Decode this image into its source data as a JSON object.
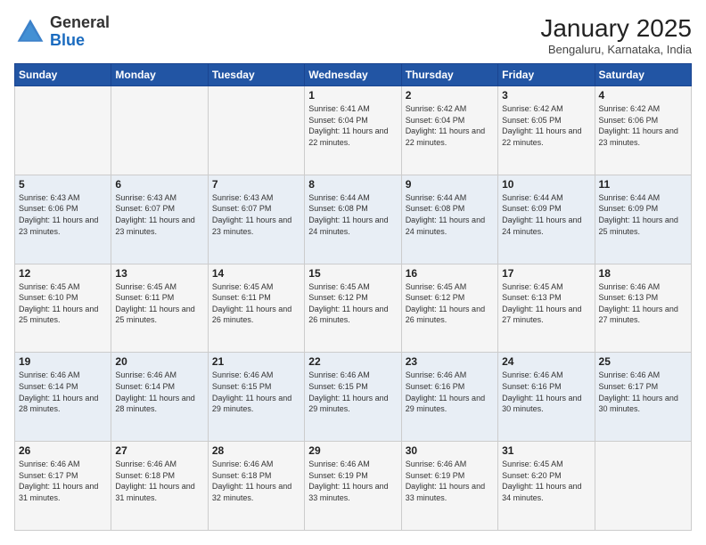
{
  "header": {
    "logo_general": "General",
    "logo_blue": "Blue",
    "month_year": "January 2025",
    "location": "Bengaluru, Karnataka, India"
  },
  "weekdays": [
    "Sunday",
    "Monday",
    "Tuesday",
    "Wednesday",
    "Thursday",
    "Friday",
    "Saturday"
  ],
  "weeks": [
    [
      {
        "day": "",
        "sunrise": "",
        "sunset": "",
        "daylight": ""
      },
      {
        "day": "",
        "sunrise": "",
        "sunset": "",
        "daylight": ""
      },
      {
        "day": "",
        "sunrise": "",
        "sunset": "",
        "daylight": ""
      },
      {
        "day": "1",
        "sunrise": "Sunrise: 6:41 AM",
        "sunset": "Sunset: 6:04 PM",
        "daylight": "Daylight: 11 hours and 22 minutes."
      },
      {
        "day": "2",
        "sunrise": "Sunrise: 6:42 AM",
        "sunset": "Sunset: 6:04 PM",
        "daylight": "Daylight: 11 hours and 22 minutes."
      },
      {
        "day": "3",
        "sunrise": "Sunrise: 6:42 AM",
        "sunset": "Sunset: 6:05 PM",
        "daylight": "Daylight: 11 hours and 22 minutes."
      },
      {
        "day": "4",
        "sunrise": "Sunrise: 6:42 AM",
        "sunset": "Sunset: 6:06 PM",
        "daylight": "Daylight: 11 hours and 23 minutes."
      }
    ],
    [
      {
        "day": "5",
        "sunrise": "Sunrise: 6:43 AM",
        "sunset": "Sunset: 6:06 PM",
        "daylight": "Daylight: 11 hours and 23 minutes."
      },
      {
        "day": "6",
        "sunrise": "Sunrise: 6:43 AM",
        "sunset": "Sunset: 6:07 PM",
        "daylight": "Daylight: 11 hours and 23 minutes."
      },
      {
        "day": "7",
        "sunrise": "Sunrise: 6:43 AM",
        "sunset": "Sunset: 6:07 PM",
        "daylight": "Daylight: 11 hours and 23 minutes."
      },
      {
        "day": "8",
        "sunrise": "Sunrise: 6:44 AM",
        "sunset": "Sunset: 6:08 PM",
        "daylight": "Daylight: 11 hours and 24 minutes."
      },
      {
        "day": "9",
        "sunrise": "Sunrise: 6:44 AM",
        "sunset": "Sunset: 6:08 PM",
        "daylight": "Daylight: 11 hours and 24 minutes."
      },
      {
        "day": "10",
        "sunrise": "Sunrise: 6:44 AM",
        "sunset": "Sunset: 6:09 PM",
        "daylight": "Daylight: 11 hours and 24 minutes."
      },
      {
        "day": "11",
        "sunrise": "Sunrise: 6:44 AM",
        "sunset": "Sunset: 6:09 PM",
        "daylight": "Daylight: 11 hours and 25 minutes."
      }
    ],
    [
      {
        "day": "12",
        "sunrise": "Sunrise: 6:45 AM",
        "sunset": "Sunset: 6:10 PM",
        "daylight": "Daylight: 11 hours and 25 minutes."
      },
      {
        "day": "13",
        "sunrise": "Sunrise: 6:45 AM",
        "sunset": "Sunset: 6:11 PM",
        "daylight": "Daylight: 11 hours and 25 minutes."
      },
      {
        "day": "14",
        "sunrise": "Sunrise: 6:45 AM",
        "sunset": "Sunset: 6:11 PM",
        "daylight": "Daylight: 11 hours and 26 minutes."
      },
      {
        "day": "15",
        "sunrise": "Sunrise: 6:45 AM",
        "sunset": "Sunset: 6:12 PM",
        "daylight": "Daylight: 11 hours and 26 minutes."
      },
      {
        "day": "16",
        "sunrise": "Sunrise: 6:45 AM",
        "sunset": "Sunset: 6:12 PM",
        "daylight": "Daylight: 11 hours and 26 minutes."
      },
      {
        "day": "17",
        "sunrise": "Sunrise: 6:45 AM",
        "sunset": "Sunset: 6:13 PM",
        "daylight": "Daylight: 11 hours and 27 minutes."
      },
      {
        "day": "18",
        "sunrise": "Sunrise: 6:46 AM",
        "sunset": "Sunset: 6:13 PM",
        "daylight": "Daylight: 11 hours and 27 minutes."
      }
    ],
    [
      {
        "day": "19",
        "sunrise": "Sunrise: 6:46 AM",
        "sunset": "Sunset: 6:14 PM",
        "daylight": "Daylight: 11 hours and 28 minutes."
      },
      {
        "day": "20",
        "sunrise": "Sunrise: 6:46 AM",
        "sunset": "Sunset: 6:14 PM",
        "daylight": "Daylight: 11 hours and 28 minutes."
      },
      {
        "day": "21",
        "sunrise": "Sunrise: 6:46 AM",
        "sunset": "Sunset: 6:15 PM",
        "daylight": "Daylight: 11 hours and 29 minutes."
      },
      {
        "day": "22",
        "sunrise": "Sunrise: 6:46 AM",
        "sunset": "Sunset: 6:15 PM",
        "daylight": "Daylight: 11 hours and 29 minutes."
      },
      {
        "day": "23",
        "sunrise": "Sunrise: 6:46 AM",
        "sunset": "Sunset: 6:16 PM",
        "daylight": "Daylight: 11 hours and 29 minutes."
      },
      {
        "day": "24",
        "sunrise": "Sunrise: 6:46 AM",
        "sunset": "Sunset: 6:16 PM",
        "daylight": "Daylight: 11 hours and 30 minutes."
      },
      {
        "day": "25",
        "sunrise": "Sunrise: 6:46 AM",
        "sunset": "Sunset: 6:17 PM",
        "daylight": "Daylight: 11 hours and 30 minutes."
      }
    ],
    [
      {
        "day": "26",
        "sunrise": "Sunrise: 6:46 AM",
        "sunset": "Sunset: 6:17 PM",
        "daylight": "Daylight: 11 hours and 31 minutes."
      },
      {
        "day": "27",
        "sunrise": "Sunrise: 6:46 AM",
        "sunset": "Sunset: 6:18 PM",
        "daylight": "Daylight: 11 hours and 31 minutes."
      },
      {
        "day": "28",
        "sunrise": "Sunrise: 6:46 AM",
        "sunset": "Sunset: 6:18 PM",
        "daylight": "Daylight: 11 hours and 32 minutes."
      },
      {
        "day": "29",
        "sunrise": "Sunrise: 6:46 AM",
        "sunset": "Sunset: 6:19 PM",
        "daylight": "Daylight: 11 hours and 33 minutes."
      },
      {
        "day": "30",
        "sunrise": "Sunrise: 6:46 AM",
        "sunset": "Sunset: 6:19 PM",
        "daylight": "Daylight: 11 hours and 33 minutes."
      },
      {
        "day": "31",
        "sunrise": "Sunrise: 6:45 AM",
        "sunset": "Sunset: 6:20 PM",
        "daylight": "Daylight: 11 hours and 34 minutes."
      },
      {
        "day": "",
        "sunrise": "",
        "sunset": "",
        "daylight": ""
      }
    ]
  ]
}
